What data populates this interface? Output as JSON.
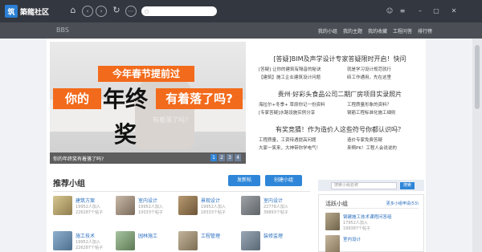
{
  "titlebar": {
    "logo_mark": "筑",
    "app_name": "築龍社区",
    "search_placeholder": ""
  },
  "nav_icons": [
    "home-icon",
    "back-icon",
    "forward-icon",
    "refresh-icon",
    "more-icon"
  ],
  "window_icons": [
    "user-icon",
    "menu-icon",
    "minimize-icon",
    "restore-icon",
    "close-icon"
  ],
  "site_header": {
    "bbs_label": "BBS",
    "nav": [
      "我的小组",
      "我的主题",
      "我的收藏",
      "工程问答",
      "排行榜"
    ]
  },
  "banner": {
    "line1": "今年春节提前过",
    "line2_left": "你的",
    "line2_big": "年终奖",
    "line2_right": "有着落了吗?",
    "ghost": "有着落了吗?",
    "caption": "你的年终奖有着落了吗?",
    "pages": [
      "1",
      "2",
      "3",
      "4"
    ]
  },
  "news": [
    {
      "headline": "[答疑]BIM及声学设计专家答疑限时开启！快问",
      "rows": [
        [
          "[答疑] 让你的建筑有隔音的秘诀",
          "就是学习设计规范就行"
        ],
        [
          "【建筑】施工企业建筑设计问题",
          "砖工作通用，先在这里"
        ]
      ]
    },
    {
      "headline": "贵州·好彩头食品公司二期厂房项目实录照片",
      "rows": [
        [
          "海拉尔+冬季+ 草原你记一份资料",
          "工程质量形象的资料？"
        ],
        [
          "[专家答疑]水路设施实例分享",
          "钢筋工程标准化施工细则"
        ]
      ]
    },
    {
      "headline": "有奖竞猜！作为造价人这些符号你都认识吗？",
      "rows": [
        [
          "工程质量，工资待遇提高问题",
          "造价专家免费答疑"
        ],
        [
          "大家一笑来，大神带你学电气！",
          "来啊PK！工程人会说说的"
        ]
      ]
    }
  ],
  "groups_section": {
    "title": "推荐小组",
    "post_button": "发新帖",
    "create_button": "创建小组",
    "cards": [
      {
        "name": "建筑方案",
        "members": "19952人加入",
        "posts": "226287个帖子"
      },
      {
        "name": "室内设计",
        "members": "19952人加入",
        "posts": "10033个帖子"
      },
      {
        "name": "景观设计",
        "members": "19952人加入",
        "posts": "18333个帖子"
      },
      {
        "name": "室内设计",
        "members": "22778人加入",
        "posts": "39893个帖子"
      },
      {
        "name": "施工技术",
        "members": "19952人加入",
        "posts": "226287个帖子"
      },
      {
        "name": "园林施工",
        "members": "",
        "posts": ""
      },
      {
        "name": "工程管理",
        "members": "",
        "posts": ""
      },
      {
        "name": "装修监理",
        "members": "",
        "posts": ""
      }
    ]
  },
  "sidebar": {
    "search_placeholder": "搜索小组名称",
    "search_button": "搜索",
    "panel_title": "活跃小组",
    "panel_more": "更多小组申请(53)",
    "items": [
      {
        "name": "钢建施工技术课程问答组",
        "members": "17952人加入",
        "posts": "199387个帖子"
      },
      {
        "name": "室内设计",
        "members": "",
        "posts": ""
      }
    ]
  },
  "colors": {
    "titlebar": "#33373f",
    "siteheader": "#4b4f55",
    "accent_orange": "#f26a1b",
    "accent_blue": "#2f86d8"
  }
}
